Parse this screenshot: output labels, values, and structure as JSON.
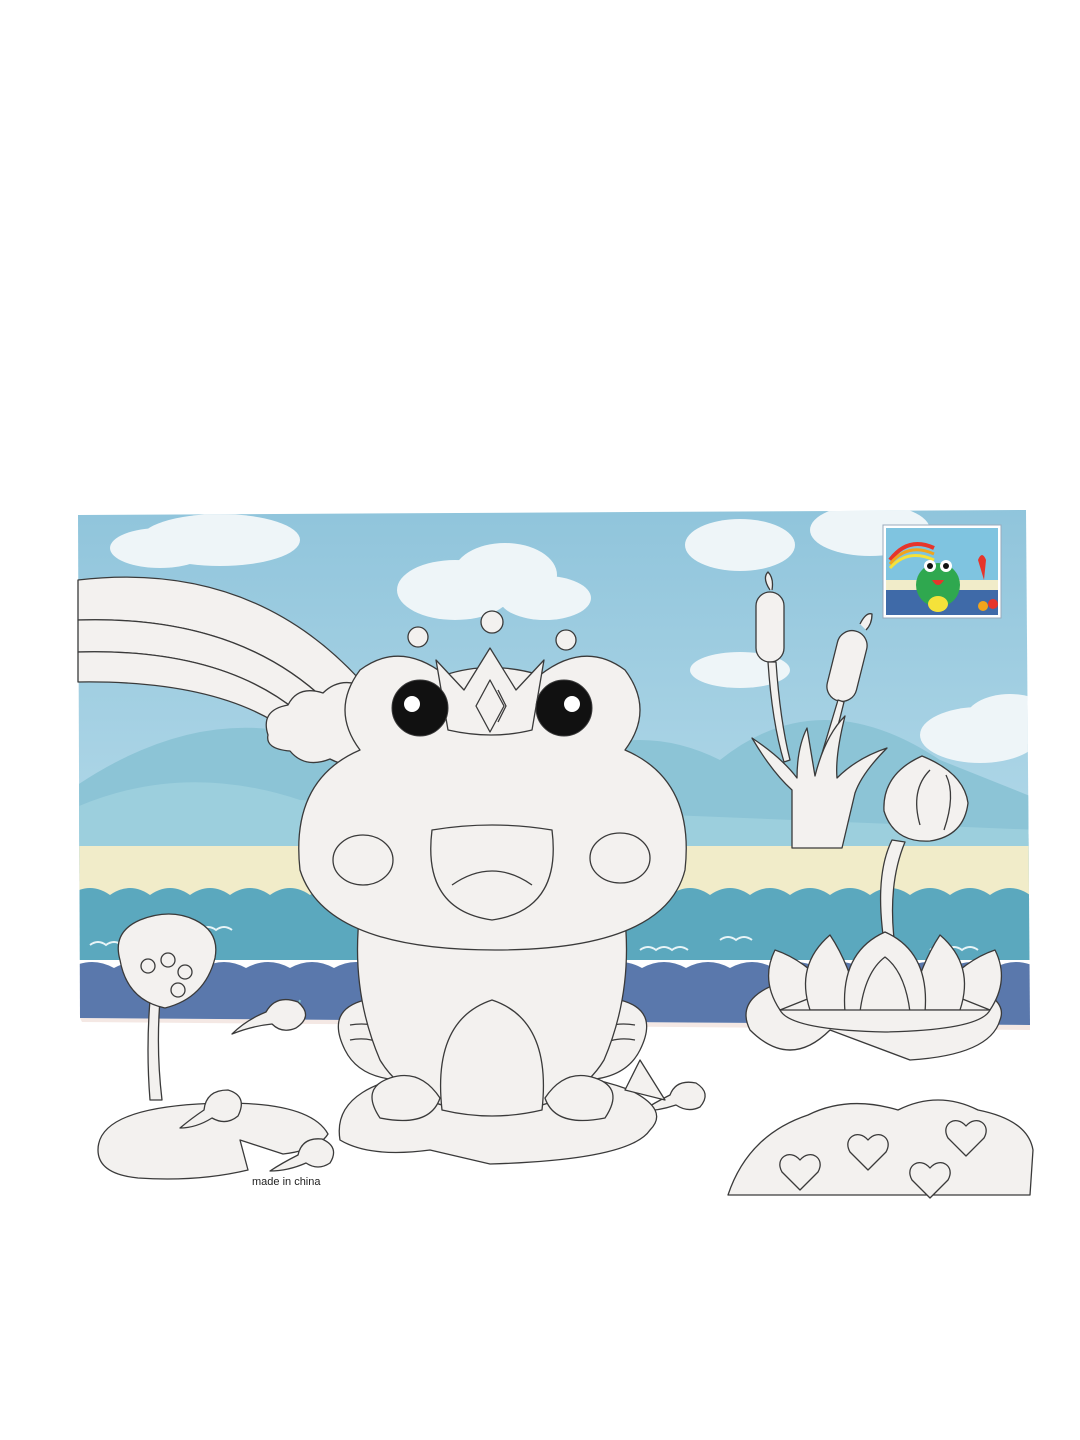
{
  "background_color": "#ffffff",
  "colors": {
    "sky": "#a9d3e6",
    "sky_top": "#9ccbe0",
    "cloud": "#eef5f8",
    "mountain": "#8dc3d6",
    "mountain_far": "#9fcfde",
    "sand": "#f1ecc9",
    "sea_light": "#5aa7bd",
    "sea_band": "#4a93b0",
    "sea_deep": "#5a79ad",
    "outline_fill": "#f3f1ef",
    "outline_stroke": "#3a3a3a",
    "eye": "#111111",
    "rainbow_red": "#e6352b",
    "rainbow_orange": "#f2a41c",
    "rainbow_yellow": "#f5e23a",
    "frog_green": "#2fa84f",
    "blush": "#f08a8a"
  },
  "card": {
    "caption": "made in china"
  },
  "reference_thumbnail": {
    "description_icon": "frog-colored-preview"
  },
  "scene_elements": [
    "rainbow",
    "frog-prince",
    "crown",
    "bubbles",
    "cattails",
    "lotus-bud",
    "lotus-flower",
    "lotus-seed-pod",
    "lily-pads",
    "tadpoles",
    "heart-rock"
  ]
}
